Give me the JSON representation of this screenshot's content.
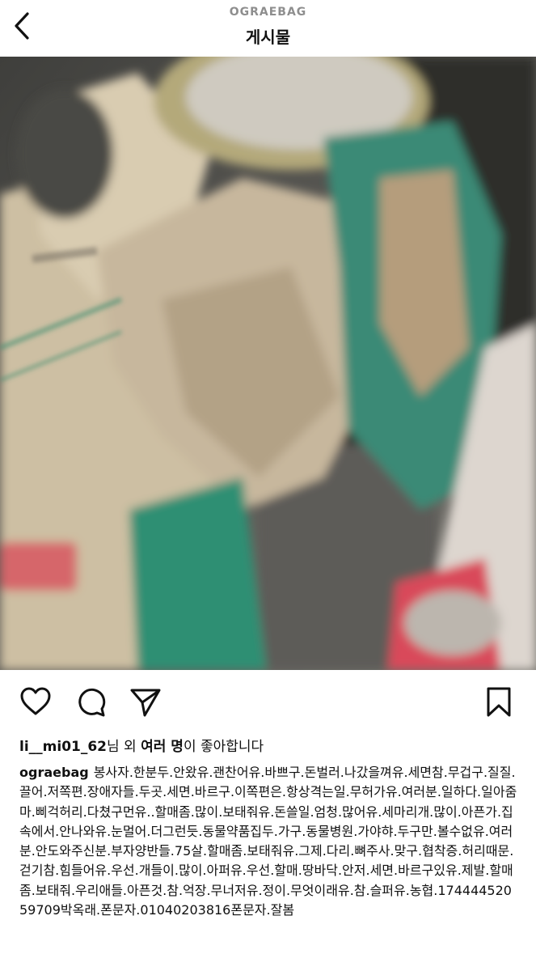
{
  "header": {
    "back_icon": "chevron-left-icon",
    "account": "OGRAEBAG",
    "title": "게시물"
  },
  "media": {
    "type": "video",
    "mute_icon": "speaker-muted-icon"
  },
  "actions": {
    "like_icon": "heart-icon",
    "comment_icon": "comment-icon",
    "share_icon": "paper-plane-icon",
    "save_icon": "bookmark-icon"
  },
  "likes": {
    "user": "li__mi01_62",
    "mid": "님 외 ",
    "bold": "여러 명",
    "tail": "이 좋아합니다"
  },
  "caption": {
    "username": "ograebag",
    "text": "봉사자.한분두.안왔유.괜찬어유.바쁘구.돈벌러.나갔을껴유.세면참.무겁구.질질.끌어.저쪽편.장애자들.두곳.세면.바르구.이쪽편은.항상격는일.무허가유.여러분.일하다.일아줌마.삐걱허리.다쳤구먼유..할매좀.많이.보태줘유.돈쓸일.엄청.많어유.세마리개.많이.아픈가.집속에서.안나와유.눈멀어.더그런듯.동물약품집두.가구.동물병원.가야햐.두구만.볼수없유.여러분.안도와주신분.부자양반들.75살.할매좀.보태줘유.그제.다리.뼈주사.맞구.협착증.허리때문.걷기참.힘들어유.우선.개들이.많이.아퍼유.우선.할매.땅바닥.안저.세면.바르구있유.제발.할매좀.보태줘.우리애들.아픈것.참.억장.무너저유.정이.무엇이래유.참.슬퍼유.농협.17444452059709박옥래.폰문자.01040203816폰문자.잘봄"
  }
}
